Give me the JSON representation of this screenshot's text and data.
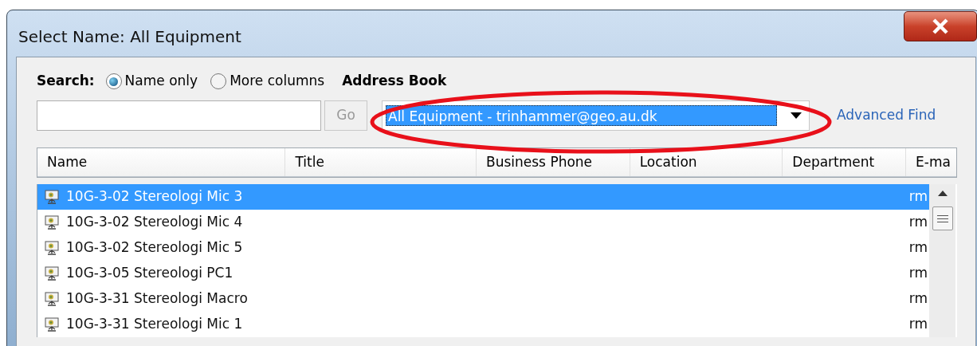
{
  "window": {
    "title": "Select Name: All Equipment"
  },
  "search": {
    "label": "Search:",
    "options": [
      {
        "label": "Name only",
        "selected": true
      },
      {
        "label": "More columns",
        "selected": false
      }
    ],
    "go_button": "Go"
  },
  "address_book": {
    "label": "Address Book",
    "value": "All Equipment - trinhammer@geo.au.dk",
    "advanced_find": "Advanced Find"
  },
  "table": {
    "columns": [
      "Name",
      "Title",
      "Business Phone",
      "Location",
      "Department",
      "E-ma"
    ],
    "rows": [
      {
        "name": "10G-3-02 Stereologi Mic 3",
        "email": "rm",
        "selected": true
      },
      {
        "name": "10G-3-02 Stereologi Mic 4",
        "email": "rm",
        "selected": false
      },
      {
        "name": "10G-3-02 Stereologi Mic 5",
        "email": "rm",
        "selected": false
      },
      {
        "name": "10G-3-05 Stereologi PC1",
        "email": "rm",
        "selected": false
      },
      {
        "name": "10G-3-31 Stereologi Macro",
        "email": "rm",
        "selected": false
      },
      {
        "name": "10G-3-31 Stereologi Mic 1",
        "email": "rm",
        "selected": false
      }
    ]
  }
}
